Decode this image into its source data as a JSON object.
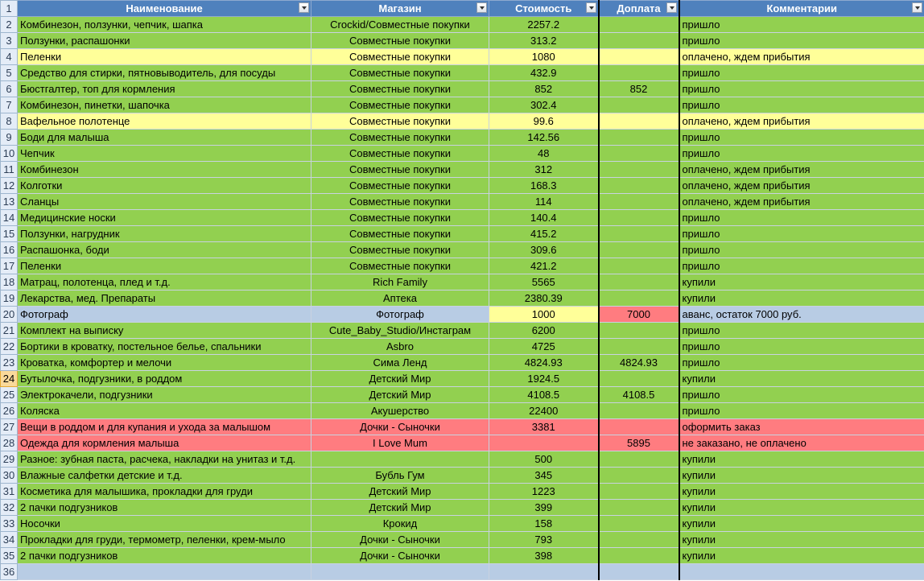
{
  "headers": [
    "Наименование",
    "Магазин",
    "Стоимость",
    "Доплата",
    "Комментарии"
  ],
  "header_row_num": "1",
  "empty_row_num": "36",
  "colors": {
    "green": "#92d050",
    "yellow": "#ffff99",
    "red": "#ff7c80",
    "light_blue": "#b8cce4",
    "header": "#4f81bd"
  },
  "rows": [
    {
      "n": "2",
      "name": "Комбинезон, ползунки, чепчик, шапка",
      "shop": "Crockid/Совместные покупки",
      "cost": "2257.2",
      "extra": "",
      "comment": "пришло",
      "color": "green"
    },
    {
      "n": "3",
      "name": "Ползунки, распашонки",
      "shop": "Совместные покупки",
      "cost": "313.2",
      "extra": "",
      "comment": "пришло",
      "color": "green"
    },
    {
      "n": "4",
      "name": "Пеленки",
      "shop": "Совместные покупки",
      "cost": "1080",
      "extra": "",
      "comment": "оплачено, ждем прибытия",
      "color": "yellow"
    },
    {
      "n": "5",
      "name": "Средство для стирки, пятновыводитель, для посуды",
      "shop": "Совместные покупки",
      "cost": "432.9",
      "extra": "",
      "comment": "пришло",
      "color": "green"
    },
    {
      "n": "6",
      "name": "Бюстгалтер, топ для кормления",
      "shop": "Совместные покупки",
      "cost": "852",
      "extra": "852",
      "comment": "пришло",
      "color": "green"
    },
    {
      "n": "7",
      "name": "Комбинезон, пинетки, шапочка",
      "shop": "Совместные покупки",
      "cost": "302.4",
      "extra": "",
      "comment": "пришло",
      "color": "green"
    },
    {
      "n": "8",
      "name": "Вафельное полотенце",
      "shop": "Совместные покупки",
      "cost": "99.6",
      "extra": "",
      "comment": "оплачено, ждем прибытия",
      "color": "yellow"
    },
    {
      "n": "9",
      "name": "Боди для малыша",
      "shop": "Совместные покупки",
      "cost": "142.56",
      "extra": "",
      "comment": "пришло",
      "color": "green"
    },
    {
      "n": "10",
      "name": "Чепчик",
      "shop": "Совместные покупки",
      "cost": "48",
      "extra": "",
      "comment": "пришло",
      "color": "green"
    },
    {
      "n": "11",
      "name": "Комбинезон",
      "shop": "Совместные покупки",
      "cost": "312",
      "extra": "",
      "comment": "оплачено, ждем прибытия",
      "color": "green"
    },
    {
      "n": "12",
      "name": "Колготки",
      "shop": "Совместные покупки",
      "cost": "168.3",
      "extra": "",
      "comment": "оплачено, ждем прибытия",
      "color": "green"
    },
    {
      "n": "13",
      "name": "Сланцы",
      "shop": "Совместные покупки",
      "cost": "114",
      "extra": "",
      "comment": "оплачено, ждем прибытия",
      "color": "green"
    },
    {
      "n": "14",
      "name": "Медицинские носки",
      "shop": "Совместные покупки",
      "cost": "140.4",
      "extra": "",
      "comment": "пришло",
      "color": "green"
    },
    {
      "n": "15",
      "name": "Ползунки, нагрудник",
      "shop": "Совместные покупки",
      "cost": "415.2",
      "extra": "",
      "comment": "пришло",
      "color": "green"
    },
    {
      "n": "16",
      "name": "Распашонка, боди",
      "shop": "Совместные покупки",
      "cost": "309.6",
      "extra": "",
      "comment": "пришло",
      "color": "green"
    },
    {
      "n": "17",
      "name": "Пеленки",
      "shop": "Совместные покупки",
      "cost": "421.2",
      "extra": "",
      "comment": "пришло",
      "color": "green"
    },
    {
      "n": "18",
      "name": "Матрац, полотенца, плед и т.д.",
      "shop": "Rich Family",
      "cost": "5565",
      "extra": "",
      "comment": "купили",
      "color": "green"
    },
    {
      "n": "19",
      "name": "Лекарства, мед. Препараты",
      "shop": "Аптека",
      "cost": "2380.39",
      "extra": "",
      "comment": "купили",
      "color": "green"
    },
    {
      "n": "20",
      "name": "Фотограф",
      "shop": "Фотограф",
      "cost": "1000",
      "extra": "7000",
      "comment": "аванс, остаток 7000 руб.",
      "color": "lblue",
      "cost_color": "yellow",
      "extra_color": "red"
    },
    {
      "n": "21",
      "name": "Комплект на выписку",
      "shop": "Cute_Baby_Studio/Инстаграм",
      "cost": "6200",
      "extra": "",
      "comment": "пришло",
      "color": "green"
    },
    {
      "n": "22",
      "name": "Бортики в кроватку, постельное белье, спальники",
      "shop": "Asbro",
      "cost": "4725",
      "extra": "",
      "comment": "пришло",
      "color": "green"
    },
    {
      "n": "23",
      "name": "Кроватка, комфортер и мелочи",
      "shop": "Сима Ленд",
      "cost": "4824.93",
      "extra": "4824.93",
      "comment": "пришло",
      "color": "green"
    },
    {
      "n": "24",
      "name": "Бутылочка, подгузники, в роддом",
      "shop": "Детский Мир",
      "cost": "1924.5",
      "extra": "",
      "comment": "купили",
      "color": "green",
      "selected": true
    },
    {
      "n": "25",
      "name": "Электрокачели, подгузники",
      "shop": "Детский Мир",
      "cost": "4108.5",
      "extra": "4108.5",
      "comment": "пришло",
      "color": "green"
    },
    {
      "n": "26",
      "name": "Коляска",
      "shop": "Акушерство",
      "cost": "22400",
      "extra": "",
      "comment": "пришло",
      "color": "green"
    },
    {
      "n": "27",
      "name": "Вещи в роддом и для купания и ухода за малышом",
      "shop": "Дочки - Сыночки",
      "cost": "3381",
      "extra": "",
      "comment": "оформить заказ",
      "color": "red"
    },
    {
      "n": "28",
      "name": "Одежда для кормления малыша",
      "shop": "I Love Mum",
      "cost": "",
      "extra": "5895",
      "comment": "не заказано, не оплачено",
      "color": "red"
    },
    {
      "n": "29",
      "name": "Разное: зубная паста, расчека, накладки на унитаз и т.д.",
      "shop": "",
      "cost": "500",
      "extra": "",
      "comment": "купили",
      "color": "green"
    },
    {
      "n": "30",
      "name": "Влажные салфетки детские и т.д.",
      "shop": "Бубль Гум",
      "cost": "345",
      "extra": "",
      "comment": "купили",
      "color": "green"
    },
    {
      "n": "31",
      "name": "Косметика для малышика, прокладки для груди",
      "shop": "Детский Мир",
      "cost": "1223",
      "extra": "",
      "comment": "купили",
      "color": "green"
    },
    {
      "n": "32",
      "name": "2 пачки подгузников",
      "shop": "Детский Мир",
      "cost": "399",
      "extra": "",
      "comment": "купили",
      "color": "green"
    },
    {
      "n": "33",
      "name": "Носочки",
      "shop": "Крокид",
      "cost": "158",
      "extra": "",
      "comment": "купили",
      "color": "green"
    },
    {
      "n": "34",
      "name": "Прокладки для груди, термометр, пеленки, крем-мыло",
      "shop": "Дочки - Сыночки",
      "cost": "793",
      "extra": "",
      "comment": "купили",
      "color": "green"
    },
    {
      "n": "35",
      "name": "2 пачки подгузников",
      "shop": "Дочки - Сыночки",
      "cost": "398",
      "extra": "",
      "comment": "купили",
      "color": "green"
    }
  ]
}
